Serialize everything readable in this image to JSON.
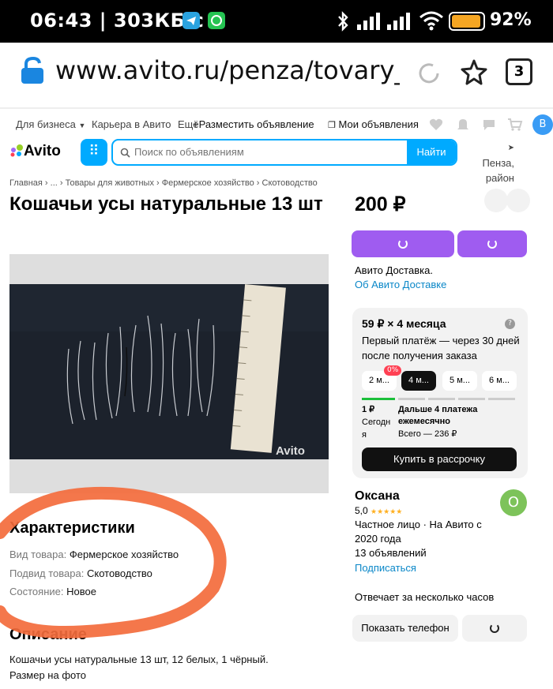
{
  "status_bar": {
    "time": "06:43 | 303КБ/с",
    "battery": "92%",
    "battery_color": "#f5a623"
  },
  "browser": {
    "url": "www.avito.ru/penza/tovary_dly",
    "tab_count": "3"
  },
  "top_nav": {
    "business": "Для бизнеса",
    "careers": "Карьера в Авито",
    "more": "Ещё",
    "post_ad": "Разместить объявление",
    "my_ads": "Мои объявления",
    "user_initial": "В"
  },
  "header": {
    "logo": "Avito",
    "search_placeholder": "Поиск по объявлениям",
    "search_button": "Найти",
    "location": "Пенза, район",
    "accent_color": "#00aaff"
  },
  "breadcrumb": "Главная › ... › Товары для животных › Фермерское хозяйство › Скотоводство",
  "listing": {
    "title": "Кошачьи усы натуральные 13 шт",
    "price": "200 ₽",
    "delivery_title": "Авито Доставка.",
    "delivery_link": "Об Авито Доставке",
    "photo_watermark": "Avito",
    "purple_color": "#9f5cf0"
  },
  "installment": {
    "heading": "59 ₽ × 4 месяца",
    "subheading": "Первый платёж — через 30 дней после получения заказа",
    "discount_badge": "0%",
    "chips": [
      "2 м...",
      "4 м...",
      "5 м...",
      "6 м..."
    ],
    "first_amount": "1 ₽",
    "first_when": "Сегодня",
    "next_label": "Дальше 4 платежа ежемесячно",
    "total": "Всего — 236 ₽",
    "buy_button": "Купить в рассрочку"
  },
  "seller": {
    "name": "Оксана",
    "rating": "5,0",
    "stars": "★★★★★",
    "type_line": "Частное лицо · На Авито с 2020 года",
    "ads_count": "13 объявлений",
    "subscribe": "Подписаться",
    "response": "Отвечает за несколько часов",
    "show_phone": "Показать телефон",
    "avatar_initial": "О"
  },
  "characteristics": {
    "heading": "Характеристики",
    "rows": [
      {
        "label": "Вид товара:",
        "value": "Фермерское хозяйство"
      },
      {
        "label": "Подвид товара:",
        "value": "Скотоводство"
      },
      {
        "label": "Состояние:",
        "value": "Новое"
      }
    ]
  },
  "description": {
    "heading": "Описание",
    "line1": "Кошачьи усы натуральные 13 шт, 12 белых, 1 чёрный.",
    "line2": "Размер на фото"
  },
  "annotation_color": "#f36b3c"
}
